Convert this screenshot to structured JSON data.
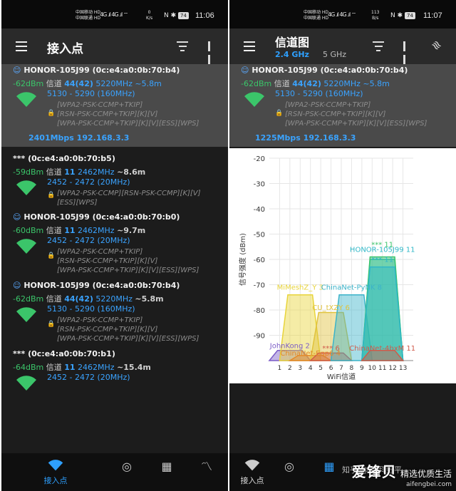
{
  "status_bar": {
    "carrier_1": "中国移动 HD",
    "carrier_2": "中国联通 HD",
    "signal": "4G .ıl 4G .ıl ⌔",
    "icons": "N ✱",
    "battery": "74",
    "left": {
      "speed_value": "0",
      "speed_unit": "K/s",
      "time": "11:06"
    },
    "right": {
      "speed_value": "113",
      "speed_unit": "B/s",
      "time": "11:07"
    }
  },
  "left_screen": {
    "title": "接入点",
    "networks": [
      {
        "name": "HONOR-105J99 (0c:e4:a0:0b:70:b4)",
        "icon": "smile",
        "dbm": "-62dBm",
        "channel_label": "信道",
        "channel": "44(42)",
        "freq": "5220MHz",
        "distance": "~5.8m",
        "range": "5130 - 5290 (160MHz)",
        "security": [
          "[WPA2-PSK-CCMP+TKIP]",
          "[RSN-PSK-CCMP+TKIP][K][V]",
          "[WPA-PSK-CCMP+TKIP][K][V][ESS][WPS]"
        ],
        "rate": "2401Mbps 192.168.3.3",
        "selected": true
      },
      {
        "name": "*** (0c:e4:a0:0b:70:b5)",
        "icon": "",
        "dbm": "-59dBm",
        "channel_label": "信道",
        "channel": "11",
        "freq": "2462MHz",
        "distance": "~8.6m",
        "range": "2452 - 2472 (20MHz)",
        "security": [
          "[WPA2-PSK-CCMP][RSN-PSK-CCMP][K][V]",
          "[ESS][WPS]"
        ]
      },
      {
        "name": "HONOR-105J99 (0c:e4:a0:0b:70:b0)",
        "icon": "smile",
        "dbm": "-60dBm",
        "channel_label": "信道",
        "channel": "11",
        "freq": "2462MHz",
        "distance": "~9.7m",
        "range": "2452 - 2472 (20MHz)",
        "security": [
          "[WPA2-PSK-CCMP+TKIP]",
          "[RSN-PSK-CCMP+TKIP][K][V]",
          "[WPA-PSK-CCMP+TKIP][K][V][ESS][WPS]"
        ]
      },
      {
        "name": "HONOR-105J99 (0c:e4:a0:0b:70:b4)",
        "icon": "smile",
        "dbm": "-62dBm",
        "channel_label": "信道",
        "channel": "44(42)",
        "freq": "5220MHz",
        "distance": "~5.8m",
        "range": "5130 - 5290 (160MHz)",
        "security": [
          "[WPA2-PSK-CCMP+TKIP]",
          "[RSN-PSK-CCMP+TKIP][K][V]",
          "[WPA-PSK-CCMP+TKIP][K][V][ESS][WPS]"
        ]
      },
      {
        "name": "*** (0c:e4:a0:0b:70:b1)",
        "icon": "",
        "dbm": "-64dBm",
        "channel_label": "信道",
        "channel": "11",
        "freq": "2462MHz",
        "distance": "~15.4m",
        "range": "2452 - 2472 (20MHz)",
        "security": []
      }
    ]
  },
  "right_screen": {
    "title": "信道图",
    "band_active": "2.4 GHz",
    "band_inactive": "5 GHz",
    "connected": {
      "name": "HONOR-105J99 (0c:e4:a0:0b:70:b4)",
      "dbm": "-62dBm",
      "channel_label": "信道",
      "channel": "44(42)",
      "freq": "5220MHz",
      "distance": "~5.8m",
      "range": "5130 - 5290 (160MHz)",
      "security": [
        "[WPA2-PSK-CCMP+TKIP]",
        "[RSN-PSK-CCMP+TKIP][K][V]",
        "[WPA-PSK-CCMP+TKIP][K][V][ESS][WPS]"
      ],
      "rate": "1225Mbps 192.168.3.3"
    }
  },
  "bottom_nav": {
    "left": {
      "active_label": "接入点"
    },
    "right": {
      "active_label": "接入点"
    }
  },
  "colors": {
    "accent": "#2ea0ff",
    "signal_green": "#3bc56a",
    "bg_dark": "#1c1c1c",
    "selected_bg": "#4a4a4a"
  },
  "icons": {
    "menu": "menu-icon",
    "filter": "filter-icon",
    "pause": "pause-icon",
    "nav_access_points": "wifi-icon",
    "nav_channel_rating": "radar-icon",
    "nav_chart": "bar-chart-icon",
    "nav_time_graph": "line-graph-icon"
  },
  "chart_data": {
    "type": "area",
    "title": "",
    "xlabel": "WiFi信道",
    "ylabel": "信号强度 (dBm)",
    "x_ticks": [
      1,
      2,
      3,
      4,
      5,
      6,
      7,
      8,
      9,
      10,
      11,
      12,
      13
    ],
    "y_ticks": [
      -20,
      -30,
      -40,
      -50,
      -60,
      -70,
      -80,
      -90
    ],
    "ylim": [
      -100,
      -20
    ],
    "xlim": [
      0,
      14
    ],
    "grid": true,
    "series": [
      {
        "name": "JohnKong 2",
        "channel": 2,
        "dbm": -96,
        "color": "#7b5cc7"
      },
      {
        "name": "MiMeshZ_Y 3",
        "channel": 3,
        "dbm": -74,
        "color": "#e8d43a"
      },
      {
        "name": "China Net-Eqp6 4",
        "channel": 4,
        "dbm": -98,
        "color": "#e58a2a"
      },
      {
        "name": "CU_tXZY 6",
        "channel": 6,
        "dbm": -81,
        "color": "#e0c23c"
      },
      {
        "name": "*** 6",
        "channel": 6,
        "dbm": -97,
        "color": "#d05a4a"
      },
      {
        "name": "ChinaNet-PyNK 8",
        "channel": 8,
        "dbm": -74,
        "color": "#3bb3c9"
      },
      {
        "name": "HONOR-105J99 11",
        "channel": 11,
        "dbm": -60,
        "color": "#2fb7c7"
      },
      {
        "name": "*** 11",
        "channel": 11,
        "dbm": -59,
        "color": "#3bc56a"
      },
      {
        "name": "*** 11",
        "channel": 11,
        "dbm": -63,
        "color": "#2fb7c7"
      },
      {
        "name": "ChinaNet-4bxM 11",
        "channel": 11,
        "dbm": -96,
        "color": "#d05a4a"
      }
    ],
    "labels": [
      {
        "text": "JohnKong 2",
        "channel": 2,
        "dbm": -95
      },
      {
        "text": "MiMeshZ_Y 3",
        "channel": 3,
        "dbm": -72
      },
      {
        "text": "ChinaNet-Eqp6 4",
        "channel": 4,
        "dbm": -98
      },
      {
        "text": "CU_tXZY 6",
        "channel": 6,
        "dbm": -80
      },
      {
        "text": "*** 6",
        "channel": 6,
        "dbm": -96
      },
      {
        "text": "ChinaNet-PyNK 8",
        "channel": 8,
        "dbm": -72
      },
      {
        "text": "HONOR-105J99 11",
        "channel": 11,
        "dbm": -57
      },
      {
        "text": "*** 11",
        "channel": 11,
        "dbm": -55
      },
      {
        "text": "*** 11",
        "channel": 11,
        "dbm": -61
      },
      {
        "text": "ChinaNet-4bxM 11",
        "channel": 11,
        "dbm": -96
      }
    ]
  },
  "watermark": {
    "zhihu": "知乎 @ 顾拜野平",
    "logo": "爱锋贝",
    "slogan": "精选优质生活",
    "site": "aifengbei.com"
  }
}
